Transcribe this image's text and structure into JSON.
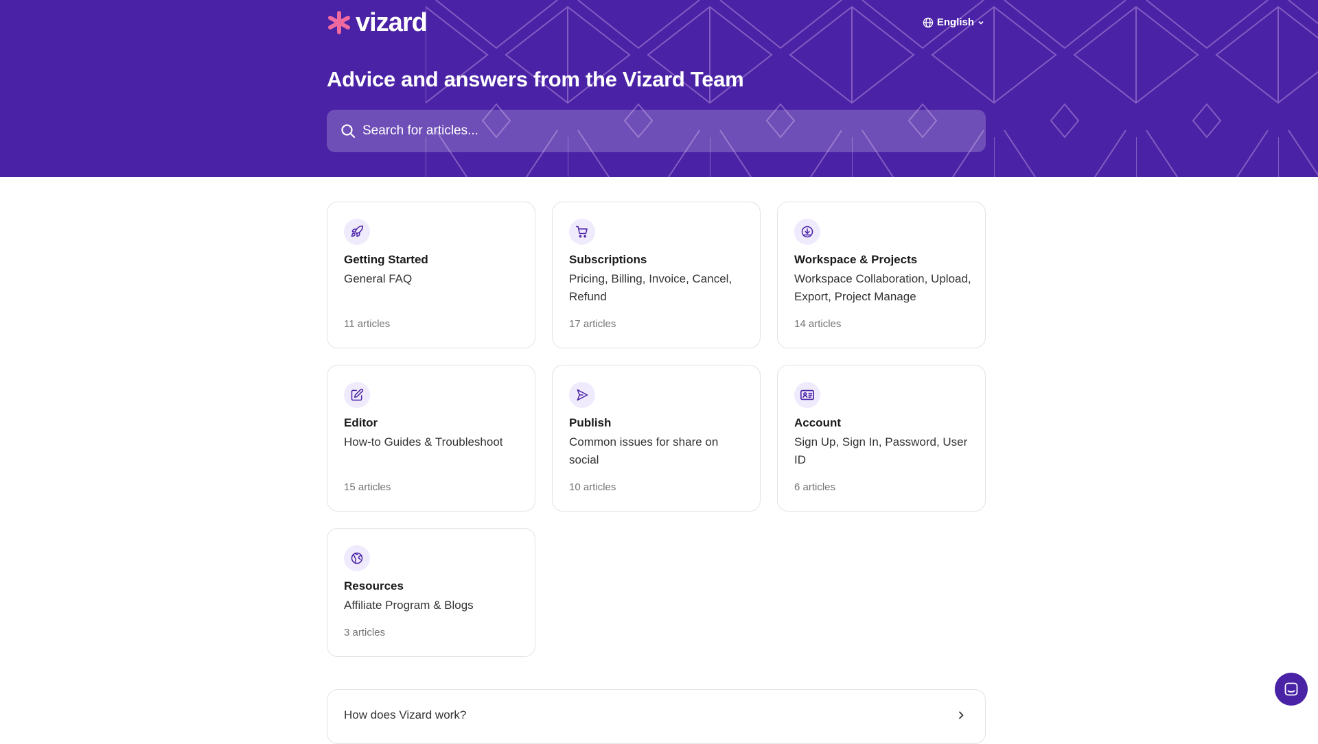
{
  "header": {
    "logo_text": "vizard",
    "language": "English",
    "title": "Advice and answers from the Vizard Team",
    "search_placeholder": "Search for articles..."
  },
  "collections": [
    {
      "icon": "rocket-icon",
      "title": "Getting Started",
      "description": "General FAQ",
      "count": "11 articles"
    },
    {
      "icon": "cart-icon",
      "title": "Subscriptions",
      "description": "Pricing, Billing, Invoice, Cancel, Refund",
      "count": "17 articles"
    },
    {
      "icon": "cloud-download-icon",
      "title": "Workspace & Projects",
      "description": "Workspace Collaboration, Upload, Export, Project Manage",
      "count": "14 articles"
    },
    {
      "icon": "edit-icon",
      "title": "Editor",
      "description": "How-to Guides & Troubleshoot",
      "count": "15 articles"
    },
    {
      "icon": "send-icon",
      "title": "Publish",
      "description": "Common issues for share on social",
      "count": "10 articles"
    },
    {
      "icon": "id-card-icon",
      "title": "Account",
      "description": "Sign Up, Sign In, Password, User ID",
      "count": "6 articles"
    },
    {
      "icon": "globe-icon",
      "title": "Resources",
      "description": "Affiliate Program & Blogs",
      "count": "3 articles"
    }
  ],
  "faq": {
    "question": "How does Vizard work?"
  },
  "colors": {
    "brand": "#4a22a6",
    "logo_accent": "#f06aa0",
    "icon_bg": "#efeafc"
  }
}
